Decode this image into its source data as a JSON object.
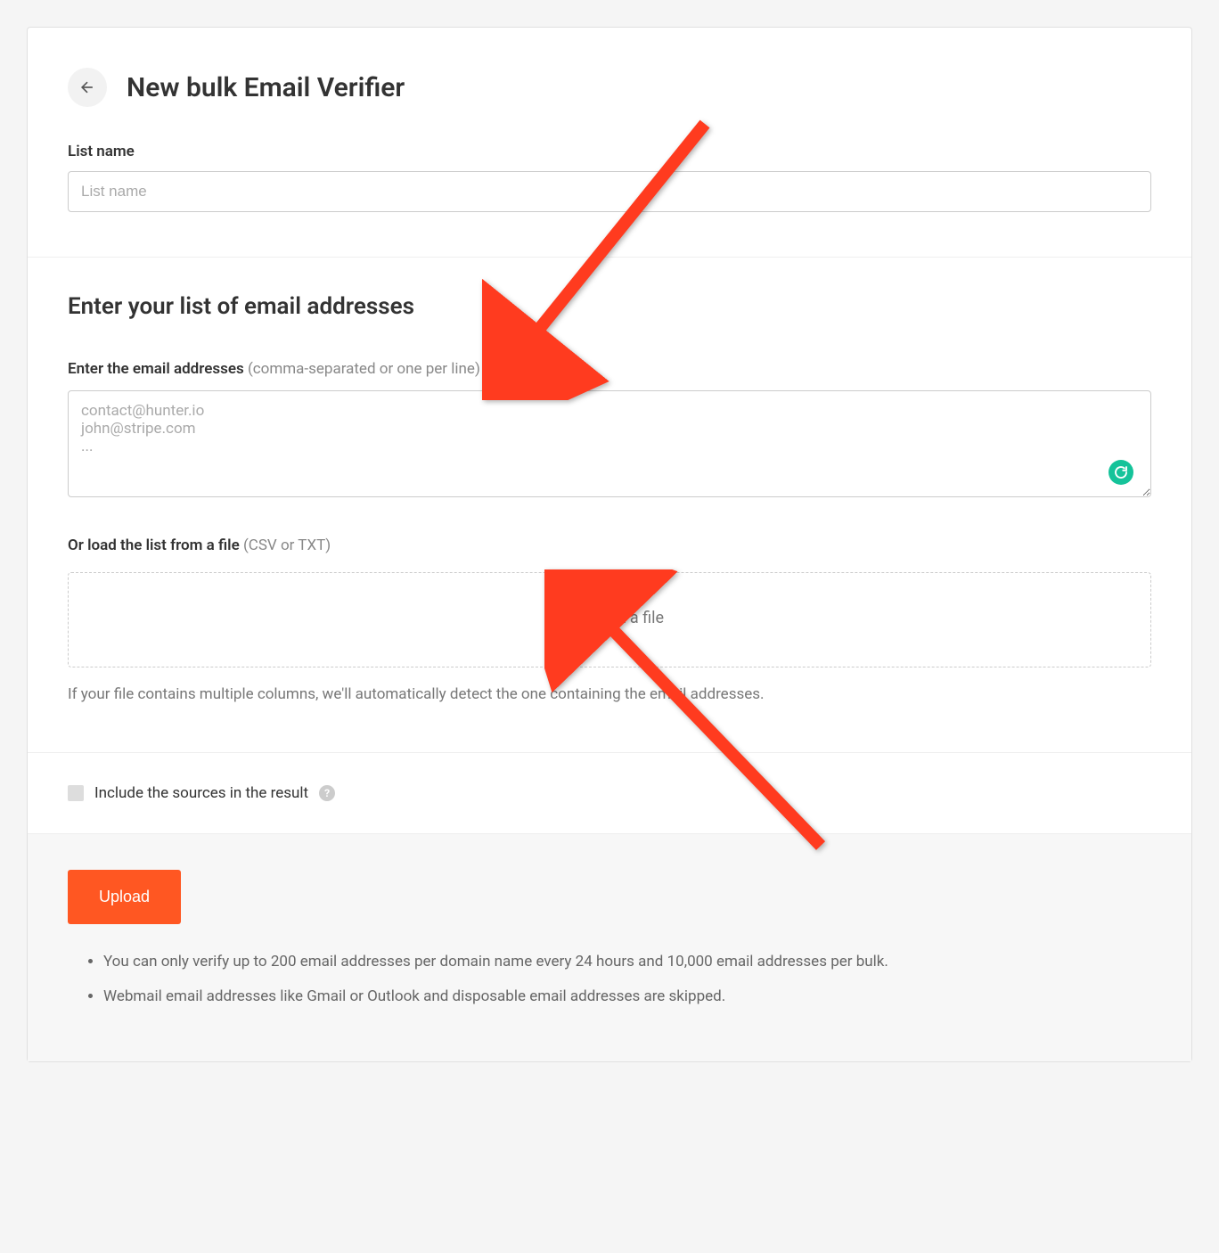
{
  "header": {
    "title": "New bulk Email Verifier",
    "listname_label": "List name",
    "listname_placeholder": "List name"
  },
  "emails": {
    "heading": "Enter your list of email addresses",
    "input_label": "Enter the email addresses",
    "input_hint": "(comma-separated or one per line)",
    "textarea_placeholder": "contact@hunter.io\njohn@stripe.com\n...",
    "file_label": "Or load the list from a file",
    "file_hint": "(CSV or TXT)",
    "file_button": "Select a file",
    "file_help": "If your file contains multiple columns, we'll automatically detect the one containing the email addresses."
  },
  "options": {
    "include_sources": "Include the sources in the result"
  },
  "footer": {
    "upload_label": "Upload",
    "notes": [
      "You can only verify up to 200 email addresses per domain name every 24 hours and 10,000 email addresses per bulk.",
      "Webmail email addresses like Gmail or Outlook and disposable email addresses are skipped."
    ]
  },
  "colors": {
    "accent": "#ff5722",
    "arrow": "#ff3b1f"
  }
}
